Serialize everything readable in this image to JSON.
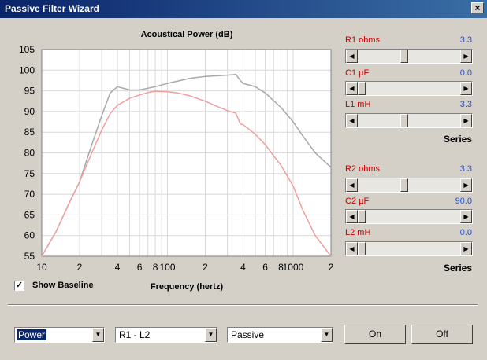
{
  "window": {
    "title": "Passive Filter Wizard",
    "close_glyph": "×"
  },
  "show_baseline": {
    "label": "Show Baseline",
    "checked": true,
    "check_glyph": "✓"
  },
  "sliders": [
    {
      "label": "R1 ohms",
      "value": "3.3",
      "position": 0.45
    },
    {
      "label": "C1 µF",
      "value": "0.0",
      "position": 0.0
    },
    {
      "label": "L1 mH",
      "value": "3.3",
      "position": 0.45
    },
    {
      "label": "R2 ohms",
      "value": "3.3",
      "position": 0.45
    },
    {
      "label": "C2 µF",
      "value": "90.0",
      "position": 0.0
    },
    {
      "label": "L2 mH",
      "value": "0.0",
      "position": 0.0
    }
  ],
  "series_labels": [
    "Series",
    "Series"
  ],
  "dropdowns": [
    {
      "value": "Power"
    },
    {
      "value": "R1 - L2"
    },
    {
      "value": "Passive"
    }
  ],
  "buttons": {
    "on": "On",
    "off": "Off"
  },
  "colors": {
    "baseline_curve": "#a8a8a8",
    "filtered_curve": "#f0a0a0",
    "slider_label": "#cc0000",
    "slider_value": "#2850c8"
  },
  "chart_data": {
    "type": "line",
    "title": "Acoustical Power (dB)",
    "xlabel": "Frequency (hertz)",
    "ylabel": "",
    "x_scale": "log",
    "xlim": [
      10,
      2000
    ],
    "ylim": [
      55,
      105
    ],
    "x_ticks": [
      {
        "v": 10,
        "label": "10"
      },
      {
        "v": 20,
        "label": "2"
      },
      {
        "v": 40,
        "label": "4"
      },
      {
        "v": 60,
        "label": "6"
      },
      {
        "v": 80,
        "label": "8"
      },
      {
        "v": 100,
        "label": "100"
      },
      {
        "v": 200,
        "label": "2"
      },
      {
        "v": 400,
        "label": "4"
      },
      {
        "v": 600,
        "label": "6"
      },
      {
        "v": 800,
        "label": "8"
      },
      {
        "v": 1000,
        "label": "1000"
      },
      {
        "v": 2000,
        "label": "2"
      }
    ],
    "y_ticks": [
      55,
      60,
      65,
      70,
      75,
      80,
      85,
      90,
      95,
      100,
      105
    ],
    "grid": true,
    "series": [
      {
        "x": [
          10,
          13,
          16,
          20,
          25,
          30,
          35,
          40,
          50,
          60,
          80,
          100,
          150,
          200,
          300,
          350,
          380,
          400,
          500,
          600,
          800,
          1000,
          1200,
          1500,
          2000
        ],
        "y": [
          55,
          61,
          67,
          73,
          82,
          89,
          94.5,
          96,
          95.2,
          95.2,
          96,
          96.8,
          98,
          98.5,
          98.8,
          99,
          97.5,
          96.8,
          96,
          94.5,
          91,
          87.5,
          84,
          80,
          76.5
        ]
      },
      {
        "x": [
          10,
          13,
          16,
          20,
          25,
          30,
          35,
          40,
          50,
          60,
          70,
          80,
          100,
          120,
          150,
          200,
          250,
          300,
          350,
          380,
          400,
          500,
          600,
          800,
          1000,
          1200,
          1500,
          2000
        ],
        "y": [
          55,
          61,
          67,
          73,
          80,
          85.5,
          89.5,
          91.5,
          93.2,
          94,
          94.6,
          94.9,
          94.8,
          94.5,
          93.8,
          92.5,
          91.2,
          90.2,
          89.6,
          87,
          86.8,
          84.5,
          82,
          77,
          72,
          66,
          60,
          55
        ]
      }
    ]
  }
}
